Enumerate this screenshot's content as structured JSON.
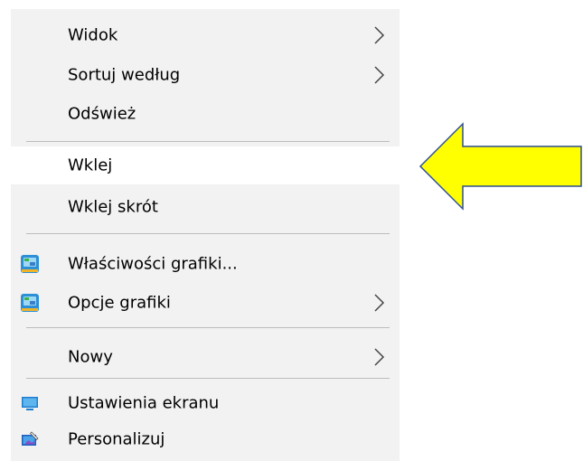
{
  "context_menu": {
    "items": [
      {
        "label": "Widok"
      },
      {
        "label": "Sortuj według"
      },
      {
        "label": "Odśwież"
      },
      {
        "label": "Wklej"
      },
      {
        "label": "Wklej skrót"
      },
      {
        "label": "Właściwości grafiki..."
      },
      {
        "label": "Opcje grafiki"
      },
      {
        "label": "Nowy"
      },
      {
        "label": "Ustawienia ekranu"
      },
      {
        "label": "Personalizuj"
      }
    ],
    "hovered_item": "Wklej",
    "icons": {
      "graphics_properties": "intel-graphics-icon",
      "graphics_options": "intel-graphics-icon",
      "display_settings": "monitor-icon",
      "personalize": "personalize-icon",
      "submenu": "chevron-right-icon"
    }
  },
  "annotation": {
    "arrow_color": "#ffff00",
    "arrow_outline_color": "#2f4f8f",
    "points_to": "Wklej"
  },
  "colors": {
    "menu_background": "#f2f2f2",
    "hover_background": "#ffffff",
    "separator": "#bcbcbc",
    "text": "#000000"
  }
}
